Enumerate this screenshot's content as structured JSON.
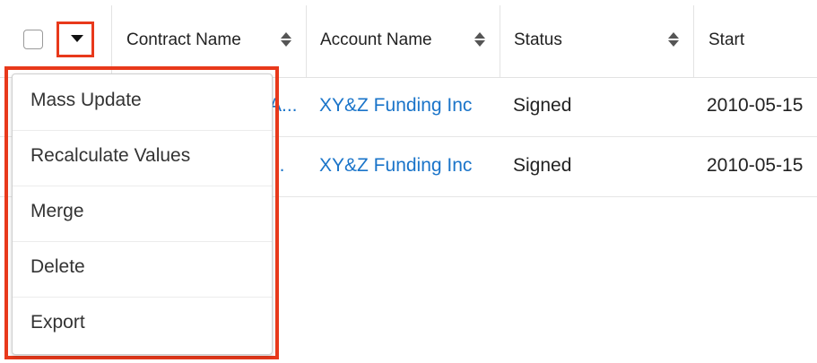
{
  "header": {
    "columns": [
      {
        "label": "Contract Name"
      },
      {
        "label": "Account Name"
      },
      {
        "label": "Status"
      },
      {
        "label": "Start"
      }
    ]
  },
  "rows": [
    {
      "contract_truncated": "A...",
      "account": "XY&Z Funding Inc",
      "status": "Signed",
      "start": "2010-05-15"
    },
    {
      "contract_truncated": "...",
      "account": "XY&Z Funding Inc",
      "status": "Signed",
      "start": "2010-05-15"
    }
  ],
  "menu": {
    "items": [
      "Mass Update",
      "Recalculate Values",
      "Merge",
      "Delete",
      "Export"
    ]
  },
  "colors": {
    "highlight": "#e8391b",
    "link": "#1a74c9"
  },
  "icons": {
    "actions_caret": "caret-down-icon",
    "sort": "sort-icon"
  }
}
